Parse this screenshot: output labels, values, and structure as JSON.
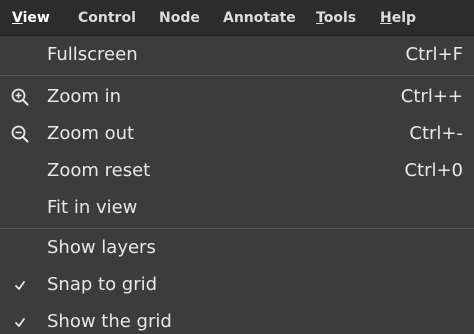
{
  "menubar": {
    "items": [
      {
        "label": "View",
        "mnemonic": "V",
        "rest": "iew"
      },
      {
        "label": "Control"
      },
      {
        "label": "Node"
      },
      {
        "label": "Annotate"
      },
      {
        "label": "Tools",
        "mnemonic": "T",
        "rest": "ools"
      },
      {
        "label": "Help",
        "mnemonic": "H",
        "rest": "elp"
      }
    ]
  },
  "menu": {
    "fullscreen": {
      "label": "Fullscreen",
      "shortcut": "Ctrl+F"
    },
    "zoom_in": {
      "label": "Zoom in",
      "shortcut": "Ctrl++",
      "icon": "zoom-in-icon"
    },
    "zoom_out": {
      "label": "Zoom out",
      "shortcut": "Ctrl+-",
      "icon": "zoom-out-icon"
    },
    "zoom_reset": {
      "label": "Zoom reset",
      "shortcut": "Ctrl+0"
    },
    "fit_in_view": {
      "label": "Fit in view"
    },
    "show_layers": {
      "label": "Show layers"
    },
    "snap_to_grid": {
      "label": "Snap to grid",
      "checked": true
    },
    "show_the_grid": {
      "label": "Show the grid",
      "checked": true
    }
  },
  "colors": {
    "menubar_bg": "#2c2c2c",
    "menu_bg": "#3c3c3c",
    "text": "#e8e8e8",
    "separator": "#555555"
  }
}
